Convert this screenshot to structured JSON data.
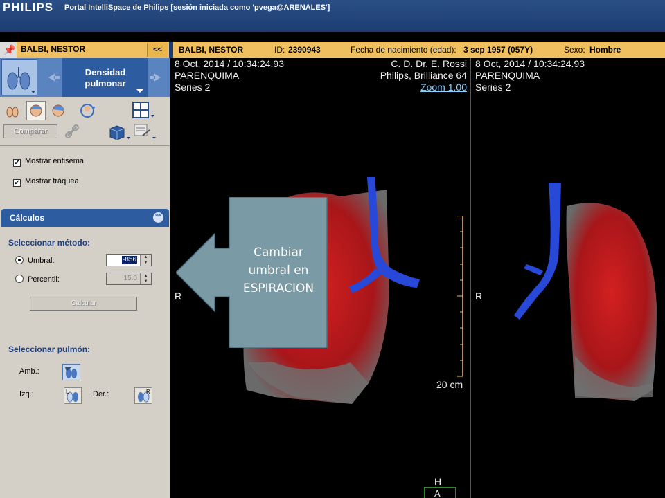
{
  "titlebar": {
    "logo": "PHILIPS",
    "title": "Portal IntelliSpace de Philips [sesión iniciada como 'pvega@ARENALES']"
  },
  "patient": {
    "left_name": "BALBI, NESTOR",
    "collapse_label": "<<",
    "name": "BALBI, NESTOR",
    "id_label": "ID:",
    "id_value": "2390943",
    "dob_label": "Fecha de nacimiento (edad):",
    "dob_value": "3 sep 1957 (057Y)",
    "sex_label": "Sexo:",
    "sex_value": "Hombre"
  },
  "nav": {
    "title": "Densidad pulmonar"
  },
  "toolbar": {
    "compare_label": "Comparar"
  },
  "options": {
    "show_emphysema": "Mostrar enfisema",
    "show_trachea": "Mostrar tráquea"
  },
  "calc": {
    "header": "Cálculos",
    "method_title": "Seleccionar método:",
    "threshold_label": "Umbral:",
    "threshold_value": "-856",
    "percentile_label": "Percentil:",
    "percentile_value": "15.0",
    "calc_button": "Calcular",
    "lung_title": "Seleccionar pulmón:",
    "amb_label": "Amb.:",
    "izq_label": "Izq.:",
    "der_label": "Der.:"
  },
  "viewport1": {
    "date": "8 Oct, 2014 / 10:34:24.93",
    "protocol": "PARENQUIMA",
    "series": "Series 2",
    "physician": "C. D. Dr. E. Rossi",
    "scanner": "Philips, Brilliance 64",
    "zoom": "Zoom 1.00",
    "orientation_left": "R",
    "scale_label": "20 cm",
    "orientation_top": "H",
    "orientation_bottom": "A"
  },
  "viewport2": {
    "date": "8 Oct, 2014 / 10:34:24.93",
    "protocol": "PARENQUIMA",
    "series": "Series 2",
    "orientation_left": "R"
  },
  "callout": {
    "line1": "Cambiar",
    "line2": "umbral en",
    "line3": "ESPIRACION"
  },
  "colors": {
    "title_blue": "#1d3d72",
    "patient_strip": "#f0c060",
    "panel_gray": "#d4d0c8",
    "section_blue": "#2e5ca0",
    "callout_fill": "#7a9aa6",
    "lung_red": "#c0181e",
    "trachea_blue": "#2848d8"
  }
}
